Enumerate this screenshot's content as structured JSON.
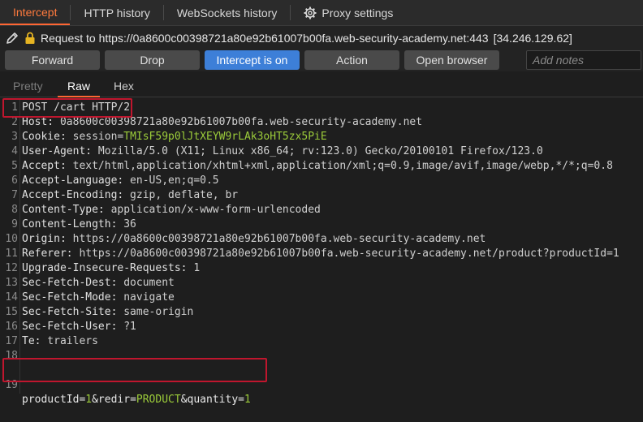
{
  "tabs": [
    {
      "label": "Intercept"
    },
    {
      "label": "HTTP history"
    },
    {
      "label": "WebSockets history"
    },
    {
      "label": "Proxy settings",
      "icon": "gear-icon"
    }
  ],
  "request": {
    "label": "Request to https://0a8600c00398721a80e92b61007b00fa.web-security-academy.net:443",
    "ip": "[34.246.129.62]"
  },
  "toolbar": {
    "forward": "Forward",
    "drop": "Drop",
    "intercept": "Intercept is on",
    "action": "Open browser",
    "action_label": "Action",
    "notes_placeholder": "Add notes"
  },
  "view_tabs": [
    "Pretty",
    "Raw",
    "Hex"
  ],
  "colors": {
    "accent": "#ff6633",
    "highlight_box": "#c0162e",
    "param_value": "#9ccc3a",
    "primary_button": "#3d7fd8"
  },
  "lines": [
    {
      "n": "1",
      "text": "POST /cart HTTP/2"
    },
    {
      "n": "2",
      "name": "Host:",
      "value": " 0a8600c00398721a80e92b61007b00fa.web-security-academy.net"
    },
    {
      "n": "3",
      "name": "Cookie:",
      "value": " session=",
      "green": "TMIsF59p0lJtXEYW9rLAk3oHT5zx5PiE"
    },
    {
      "n": "4",
      "name": "User-Agent:",
      "value": " Mozilla/5.0 (X11; Linux x86_64; rv:123.0) Gecko/20100101 Firefox/123.0"
    },
    {
      "n": "5",
      "name": "Accept:",
      "value": " text/html,application/xhtml+xml,application/xml;q=0.9,image/avif,image/webp,*/*;q=0.8"
    },
    {
      "n": "6",
      "name": "Accept-Language:",
      "value": " en-US,en;q=0.5"
    },
    {
      "n": "7",
      "name": "Accept-Encoding:",
      "value": " gzip, deflate, br"
    },
    {
      "n": "8",
      "name": "Content-Type:",
      "value": " application/x-www-form-urlencoded"
    },
    {
      "n": "9",
      "name": "Content-Length:",
      "value": " 36"
    },
    {
      "n": "10",
      "name": "Origin:",
      "value": " https://0a8600c00398721a80e92b61007b00fa.web-security-academy.net"
    },
    {
      "n": "11",
      "name": "Referer:",
      "value": " https://0a8600c00398721a80e92b61007b00fa.web-security-academy.net/product?productId=1"
    },
    {
      "n": "12",
      "name": "Upgrade-Insecure-Requests:",
      "value": " 1"
    },
    {
      "n": "13",
      "name": "Sec-Fetch-Dest:",
      "value": " document"
    },
    {
      "n": "14",
      "name": "Sec-Fetch-Mode:",
      "value": " navigate"
    },
    {
      "n": "15",
      "name": "Sec-Fetch-Site:",
      "value": " same-origin"
    },
    {
      "n": "16",
      "name": "Sec-Fetch-User:",
      "value": " ?1"
    },
    {
      "n": "17",
      "name": "Te:",
      "value": " trailers"
    },
    {
      "n": "18",
      "text": ""
    }
  ],
  "body": {
    "n": "19",
    "p1": "productId=",
    "v1": "1",
    "p2": "&redir=",
    "v2": "PRODUCT",
    "p3": "&quantity=",
    "v3": "1"
  }
}
